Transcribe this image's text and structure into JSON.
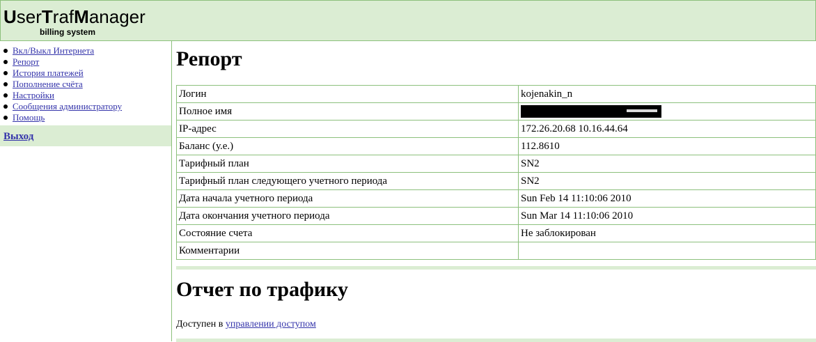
{
  "header": {
    "logo_parts": [
      {
        "text": "U",
        "bold": true
      },
      {
        "text": "ser",
        "bold": false
      },
      {
        "text": "T",
        "bold": true
      },
      {
        "text": "raf",
        "bold": false
      },
      {
        "text": "M",
        "bold": true
      },
      {
        "text": "anager",
        "bold": false
      }
    ],
    "subtitle": "billing system"
  },
  "sidebar": {
    "items": [
      {
        "label": "Вкл/Выкл Интернета"
      },
      {
        "label": "Репорт"
      },
      {
        "label": "История платежей"
      },
      {
        "label": "Пополнение счёта"
      },
      {
        "label": "Настройки"
      },
      {
        "label": "Сообщения администратору"
      },
      {
        "label": "Помощь"
      }
    ],
    "exit_label": "Выход"
  },
  "main": {
    "report_title": "Репорт",
    "rows": [
      {
        "key": "Логин",
        "value": "kojenakin_n"
      },
      {
        "key": "Полное имя",
        "value": ""
      },
      {
        "key": "IP-адрес",
        "value": "172.26.20.68 10.16.44.64"
      },
      {
        "key": "Баланс (у.е.)",
        "value": "112.8610"
      },
      {
        "key": "Тарифный план",
        "value": "SN2"
      },
      {
        "key": "Тарифный план следующего учетного периода",
        "value": "SN2"
      },
      {
        "key": "Дата начала учетного периода",
        "value": "Sun Feb 14 11:10:06 2010"
      },
      {
        "key": "Дата окончания учетного периода",
        "value": "Sun Mar 14 11:10:06 2010"
      },
      {
        "key": "Состояние счета",
        "value": "Не заблокирован"
      },
      {
        "key": "Комментарии",
        "value": ""
      }
    ],
    "traffic_title": "Отчет по трафику",
    "access_prefix": "Доступен в ",
    "access_link": "управлении доступом"
  }
}
